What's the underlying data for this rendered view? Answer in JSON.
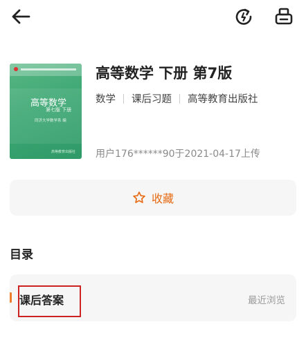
{
  "topbar": {
    "back_icon": "arrow-left-icon",
    "refresh_icon": "refresh-icon",
    "print_icon": "print-icon"
  },
  "book": {
    "title": "高等数学 下册 第7版",
    "tags": [
      "数学",
      "课后习题",
      "高等教育出版社"
    ],
    "uploader": "用户176******90于2021-04-17上传",
    "cover": {
      "title": "高等数学",
      "edition": "第七版  下册",
      "author": "同济大学数学系  编",
      "publisher": "高等教育出版社"
    }
  },
  "favorite": {
    "label": "收藏",
    "icon": "star-outline-icon"
  },
  "toc": {
    "heading": "目录",
    "items": [
      {
        "label": "课后答案",
        "hint": "最近浏览"
      }
    ]
  },
  "colors": {
    "accent": "#e66a12",
    "cover_green": "#3ea874",
    "highlight": "#cc2222"
  }
}
